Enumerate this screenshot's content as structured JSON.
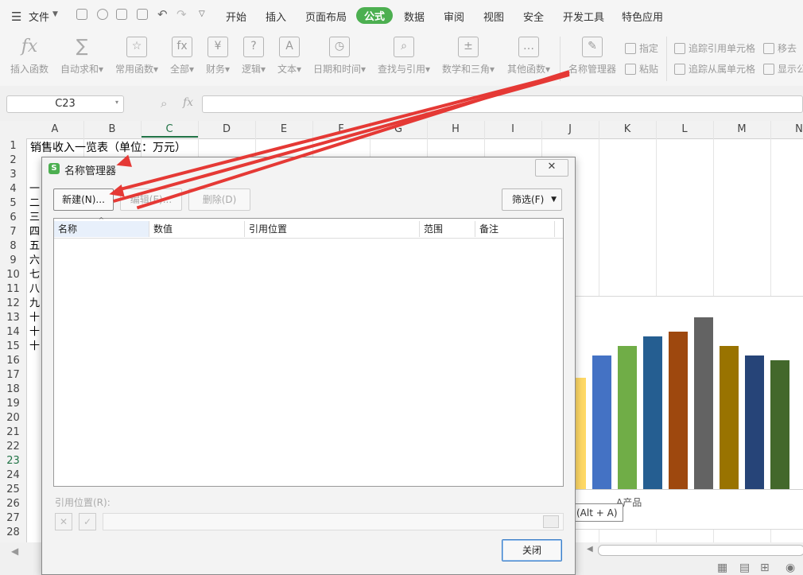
{
  "menubar": {
    "file_label": "文件",
    "tabs": [
      "开始",
      "插入",
      "页面布局",
      "公式",
      "数据",
      "审阅",
      "视图",
      "安全",
      "开发工具",
      "特色应用"
    ],
    "active_tab": "公式"
  },
  "ribbon": {
    "insert_function": "插入函数",
    "autosum": "自动求和",
    "common_functions": "常用函数",
    "all": "全部",
    "financial": "财务",
    "logical": "逻辑",
    "text": "文本",
    "datetime": "日期和时间",
    "lookup": "查找与引用",
    "math": "数学和三角",
    "other": "其他函数",
    "name_manager": "名称管理器",
    "specify": "指定",
    "paste": "粘贴",
    "trace_precedents": "追踪引用单元格",
    "trace_dependents": "追踪从属单元格",
    "remove_arrows": "移去",
    "show_formulas": "显示公"
  },
  "formula_bar": {
    "cell_ref": "C23",
    "fx": "fx",
    "value": ""
  },
  "sheet": {
    "columns": [
      "A",
      "B",
      "C",
      "D",
      "E",
      "F",
      "G",
      "H",
      "I",
      "J",
      "K",
      "L",
      "M",
      "N"
    ],
    "rows": [
      "1",
      "2",
      "3",
      "4",
      "5",
      "6",
      "7",
      "8",
      "9",
      "10",
      "11",
      "12",
      "13",
      "14",
      "15",
      "16",
      "17",
      "18",
      "19",
      "20",
      "21",
      "22",
      "23",
      "24",
      "25",
      "26",
      "27",
      "28"
    ],
    "a1_text": "销售收入一览表（单位：万元）",
    "a_column_fragments": [
      "一",
      "二",
      "三",
      "四",
      "五",
      "六",
      "七",
      "八",
      "九",
      "十",
      "十",
      "十"
    ],
    "selected_row": "23"
  },
  "chart_data": {
    "type": "bar",
    "categories": [
      "A产品"
    ],
    "series_colors": [
      "#ffd966",
      "#4472c4",
      "#70ad47",
      "#255e91",
      "#9e480e",
      "#636363",
      "#997300",
      "#264478",
      "#43682b"
    ],
    "values": [
      140,
      168,
      180,
      192,
      198,
      216,
      180,
      168,
      162
    ],
    "xlabel": "A产品",
    "ylim": [
      0,
      230
    ]
  },
  "dialog": {
    "title": "名称管理器",
    "new_button": "新建(N)...",
    "edit_button": "编辑(E)...",
    "delete_button": "删除(D)",
    "filter_button": "筛选(F)",
    "columns": [
      "名称",
      "数值",
      "引用位置",
      "范围",
      "备注"
    ],
    "refers_to_label": "引用位置(R):",
    "close_button": "关闭"
  },
  "tooltip": "截图(Alt + A)",
  "colors": {
    "accent": "#4caf50",
    "arrow": "#e53935"
  }
}
